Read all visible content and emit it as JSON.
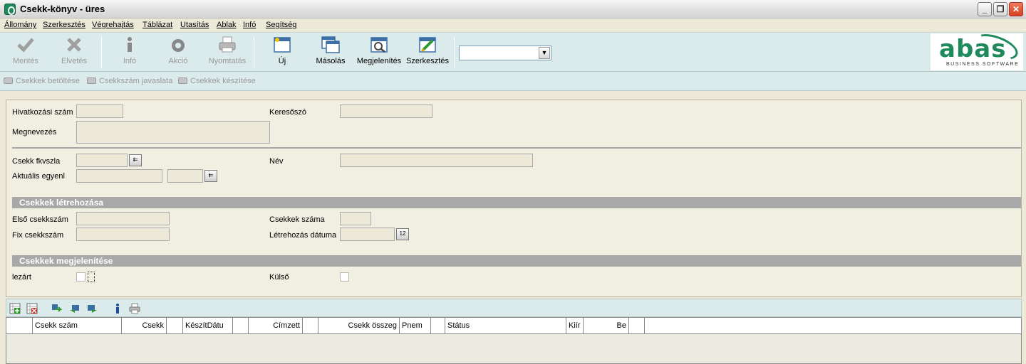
{
  "window": {
    "title": "Csekk-könyv - üres",
    "controls": [
      "_",
      "❐",
      "✕"
    ]
  },
  "menu": [
    "Állomány",
    "Szerkesztés",
    "Végrehajtás",
    "Táblázat",
    "Utasítás",
    "Ablak",
    "Infó",
    "Segítség"
  ],
  "toolbar": {
    "save": "Mentés",
    "discard": "Elvetés",
    "info": "Infó",
    "action": "Akció",
    "print": "Nyomtatás",
    "new": "Új",
    "copy": "Másolás",
    "display": "Megjelenítés",
    "edit": "Szerkesztés",
    "combo_value": ""
  },
  "logo": {
    "main": "abas",
    "sub": "BUSINESS SOFTWARE"
  },
  "actions": [
    "Csekkek betöltése",
    "Csekkszám javaslata",
    "Csekkek készítése"
  ],
  "form": {
    "reference_number": "Hivatkozási szám",
    "search_word": "Keresőszó",
    "designation": "Megnevezés",
    "check_account": "Csekk fkvszla",
    "name": "Név",
    "current_balance": "Aktuális egyenl",
    "section_create": "Csekkek létrehozása",
    "first_check_number": "Első csekkszám",
    "number_of_checks": "Csekkek száma",
    "fixed_check_number": "Fix csekkszám",
    "creation_date": "Létrehozás dátuma",
    "section_display": "Csekkek megjelenítése",
    "closed": "lezárt",
    "external": "Külső",
    "calendar_glyph": "12",
    "pick_glyph": "⇇"
  },
  "grid": {
    "columns": [
      "",
      "Csekk szám",
      "Csekk",
      "",
      "KészítDátu",
      "",
      "Címzett",
      "",
      "Csekk összeg",
      "Pnem",
      "",
      "Státus",
      "Kiír",
      "Be",
      ""
    ]
  }
}
